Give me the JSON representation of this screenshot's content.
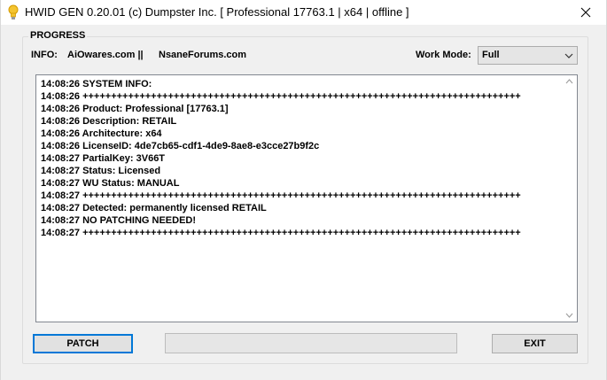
{
  "window": {
    "title": "HWID GEN 0.20.01 (c) Dumpster Inc. [ Professional 17763.1 | x64 | offline ]"
  },
  "progress_group": {
    "label": "PROGRESS",
    "info_label": "INFO:",
    "info_link_1": "AiOwares.com ||",
    "info_link_2": "NsaneForums.com"
  },
  "work_mode": {
    "label": "Work Mode:",
    "selected": "Full"
  },
  "log": {
    "lines": [
      "14:08:26 SYSTEM INFO:",
      "14:08:26 +++++++++++++++++++++++++++++++++++++++++++++++++++++++++++++++++++++++++++++",
      "14:08:26 Product: Professional [17763.1]",
      "14:08:26 Description: RETAIL",
      "14:08:26 Architecture: x64",
      "14:08:26 LicenseID: 4de7cb65-cdf1-4de9-8ae8-e3cce27b9f2c",
      "14:08:27 PartialKey: 3V66T",
      "14:08:27 Status: Licensed",
      "14:08:27 WU Status: MANUAL",
      "14:08:27 +++++++++++++++++++++++++++++++++++++++++++++++++++++++++++++++++++++++++++++",
      "14:08:27 Detected: permanently licensed RETAIL",
      "14:08:27 NO PATCHING NEEDED!",
      "14:08:27 +++++++++++++++++++++++++++++++++++++++++++++++++++++++++++++++++++++++++++++"
    ]
  },
  "buttons": {
    "patch": "PATCH",
    "exit": "EXIT"
  },
  "progress_bar": {
    "value": 0
  },
  "icons": {
    "app": "lightbulb-icon",
    "close": "close-icon",
    "dropdown": "chevron-down-icon"
  },
  "colors": {
    "accent": "#0078d7",
    "desktop": "#d7383b"
  }
}
